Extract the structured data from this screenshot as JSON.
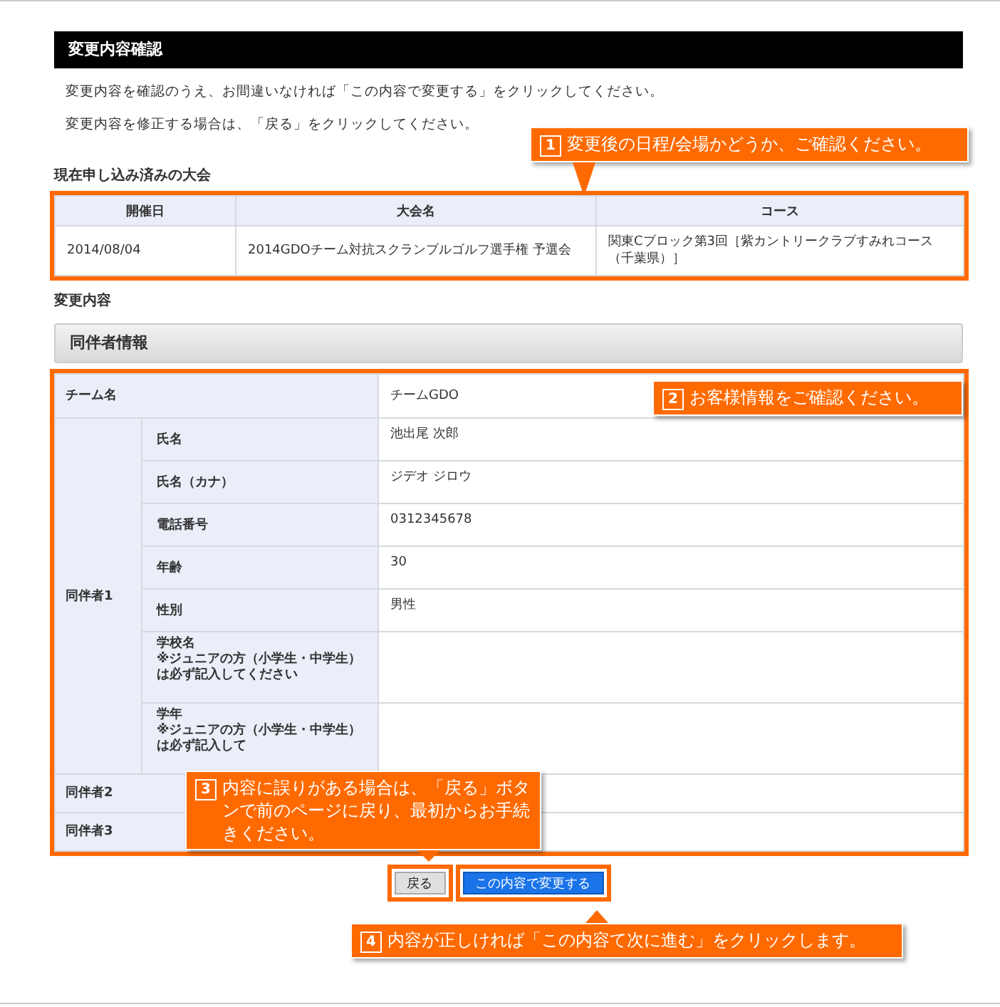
{
  "title": "変更内容確認",
  "intro": [
    "変更内容を確認のうえ、お間違いなければ「この内容で変更する」をクリックしてください。",
    "変更内容を修正する場合は、「戻る」をクリックしてください。"
  ],
  "current": {
    "heading": "現在申し込み済みの大会",
    "columns": [
      "開催日",
      "大会名",
      "コース"
    ],
    "rows": [
      [
        "2014/08/04",
        "2014GDOチーム対抗スクランブルゴルフ選手権 予選会",
        "関東Cブロック第3回［紫カントリークラブすみれコース（千葉県）］"
      ]
    ]
  },
  "changes_heading": "変更内容",
  "section_title": "同伴者情報",
  "team": {
    "label": "チーム名",
    "value": "チームGDO"
  },
  "companions": [
    {
      "label": "同伴者1",
      "fields": [
        {
          "label": "氏名",
          "value": "池出尾 次郎"
        },
        {
          "label": "氏名（カナ）",
          "value": "ジデオ ジロウ"
        },
        {
          "label": "電話番号",
          "value": "0312345678"
        },
        {
          "label": "年齢",
          "value": "30"
        },
        {
          "label": "性別",
          "value": "男性"
        },
        {
          "label": "学校名",
          "note": "※ジュニアの方（小学生・中学生）は必ず記入してください"
        },
        {
          "label": "学年",
          "note": "※ジュニアの方（小学生・中学生）は必ず記入して"
        }
      ]
    },
    {
      "label": "同伴者2"
    },
    {
      "label": "同伴者3"
    }
  ],
  "buttons": [
    {
      "label": "戻る",
      "kind": "secondary"
    },
    {
      "label": "この内容で変更する",
      "kind": "primary"
    }
  ],
  "callouts": [
    {
      "number": "1",
      "text": "変更後の日程/会場かどうか、ご確認ください。",
      "kind": "down"
    },
    {
      "number": "2",
      "text": "お客様情報をご確認ください。",
      "kind": "plain"
    },
    {
      "number": "3",
      "text": "内容に誤りがある場合は、「戻る」ボタンで前のページに戻り、最初からお手続きください。",
      "kind": "down"
    },
    {
      "number": "4",
      "text": "内容が正しければ「この内容て次に進む」をクリックします。",
      "kind": "up"
    }
  ]
}
